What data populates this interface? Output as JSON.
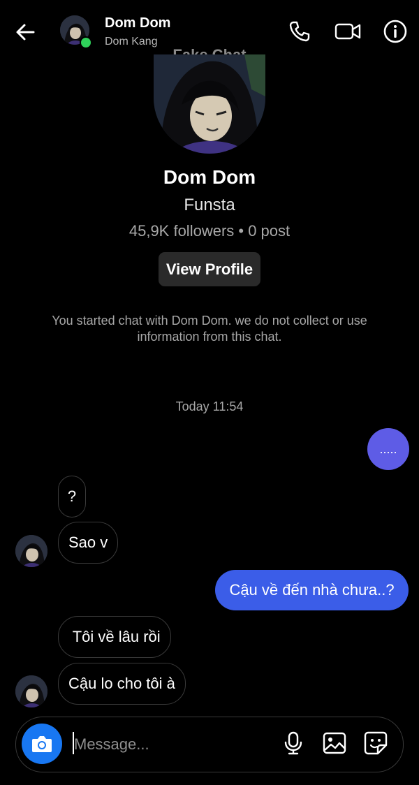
{
  "header": {
    "name": "Dom Dom",
    "username": "Dom Kang",
    "watermark": "Fake Chat",
    "icons": [
      "back-arrow-icon",
      "phone-icon",
      "video-camera-icon",
      "info-icon"
    ]
  },
  "profile": {
    "name": "Dom Dom",
    "subtitle": "Funsta",
    "stats": "45,9K followers • 0 post",
    "view_profile_label": "View Profile",
    "notice": "You started chat with Dom Dom. we do not collect or use information from this chat."
  },
  "conversation": {
    "timestamp": "Today 11:54",
    "messages": [
      {
        "sender": "me",
        "text": "....."
      },
      {
        "sender": "them",
        "text": "?"
      },
      {
        "sender": "them",
        "text": "Sao v"
      },
      {
        "sender": "me",
        "text": "Cậu về đến nhà chưa..?"
      },
      {
        "sender": "them",
        "text": " Tôi về lâu rồi"
      },
      {
        "sender": "them",
        "text": "Cậu lo cho tôi à"
      }
    ]
  },
  "composer": {
    "placeholder": "Message...",
    "icons": [
      "camera-icon",
      "microphone-icon",
      "image-icon",
      "sticker-icon"
    ]
  },
  "colors": {
    "background": "#000000",
    "outgoing_bubble": "#3b5de8",
    "typing_bubble": "#5e5ce6",
    "online_indicator": "#2fd15a",
    "camera_button": "#1877f2"
  }
}
